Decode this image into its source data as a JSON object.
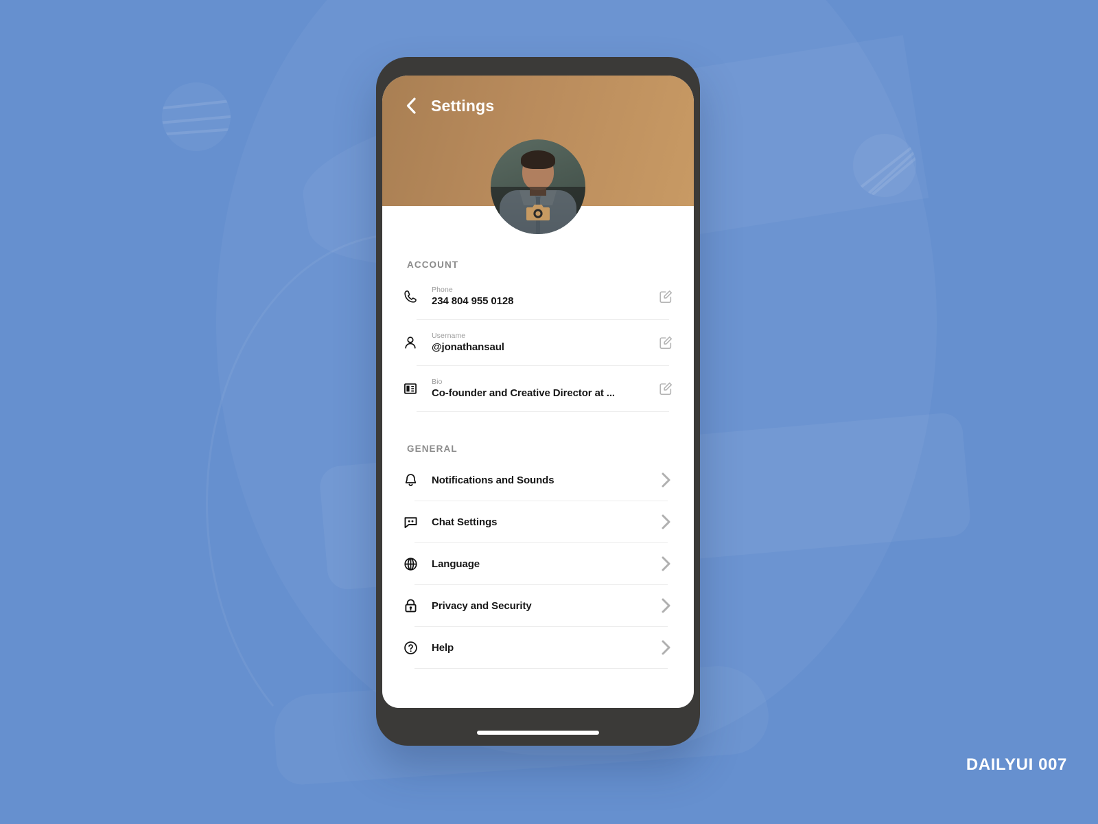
{
  "background": {
    "color": "#6690cf",
    "accent": "#ffffff"
  },
  "watermark": "DAILYUI 007",
  "phone": {
    "frame_color": "#3b3a38",
    "screen_color": "#ffffff"
  },
  "header": {
    "title": "Settings",
    "back_icon": "chevron-left-icon",
    "gradient_from": "#a97f53",
    "gradient_to": "#c89a64"
  },
  "avatar": {
    "alt": "profile-photo",
    "edit_icon": "camera-icon"
  },
  "sections": [
    {
      "label": "ACCOUNT",
      "type": "account",
      "rows": [
        {
          "icon": "phone-icon",
          "sub": "Phone",
          "value": "234 804 955 0128",
          "action_icon": "edit-pencil-icon"
        },
        {
          "icon": "user-icon",
          "sub": "Username",
          "value": "@jonathansaul",
          "action_icon": "edit-pencil-icon"
        },
        {
          "icon": "bio-icon",
          "sub": "Bio",
          "value": "Co-founder and Creative Director at ...",
          "action_icon": "edit-pencil-icon"
        }
      ]
    },
    {
      "label": "GENERAL",
      "type": "general",
      "rows": [
        {
          "icon": "bell-icon",
          "title": "Notifications and Sounds",
          "action_icon": "chevron-right-icon"
        },
        {
          "icon": "chat-bubble-icon",
          "title": "Chat Settings",
          "action_icon": "chevron-right-icon"
        },
        {
          "icon": "globe-icon",
          "title": "Language",
          "action_icon": "chevron-right-icon"
        },
        {
          "icon": "lock-icon",
          "title": "Privacy and Security",
          "action_icon": "chevron-right-icon"
        },
        {
          "icon": "question-circle-icon",
          "title": "Help",
          "action_icon": "chevron-right-icon"
        }
      ]
    }
  ]
}
